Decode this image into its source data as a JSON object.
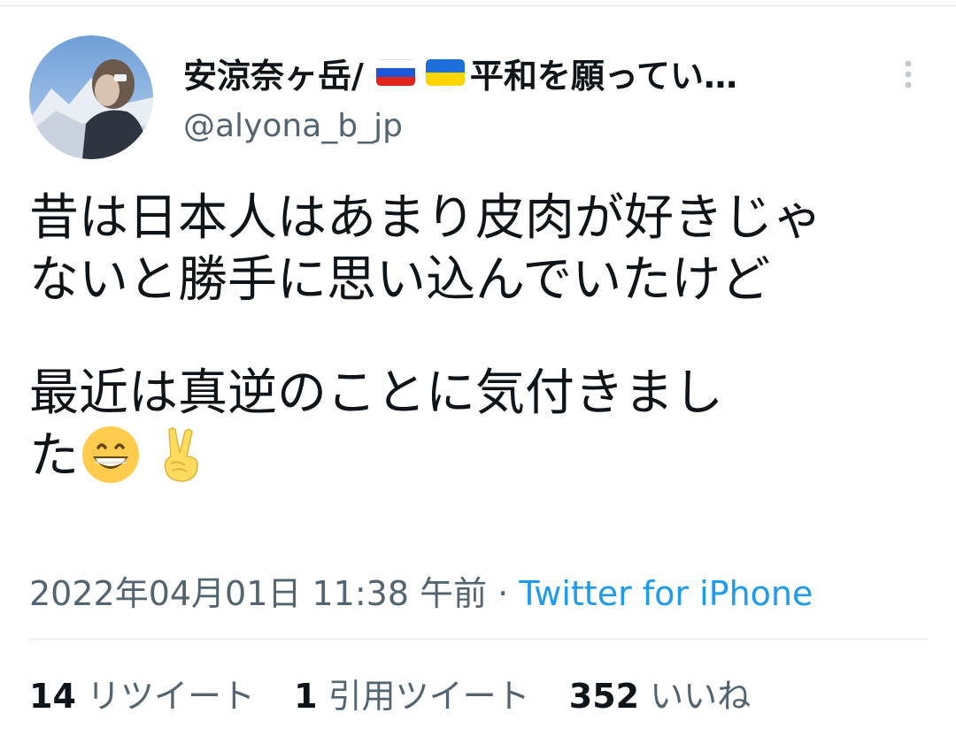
{
  "user": {
    "display_name": "安涼奈ヶ岳/ ",
    "flags": [
      "russia-flag",
      "ukraine-flag"
    ],
    "display_name_suffix": "平和を願ってい…",
    "handle": "@alyona_b_jp"
  },
  "tweet": {
    "lines": [
      "昔は日本人はあまり皮肉が好きじゃ",
      "ないと勝手に思い込んでいたけど",
      "最近は真逆のことに気付きまし",
      "た"
    ],
    "emojis": [
      "grinning-face-icon",
      "victory-hand-icon"
    ]
  },
  "meta": {
    "timestamp": "2022年04月01日 11:38 午前",
    "separator": " · ",
    "source": "Twitter for iPhone"
  },
  "stats": {
    "retweets_count": "14",
    "retweets_label": "リツイート",
    "quotes_count": "1",
    "quotes_label": "引用ツイート",
    "likes_count": "352",
    "likes_label": "いいね"
  },
  "colors": {
    "text": "#0f1419",
    "secondary": "#536471",
    "link": "#1d9bf0",
    "divider": "#e6e9ec"
  }
}
